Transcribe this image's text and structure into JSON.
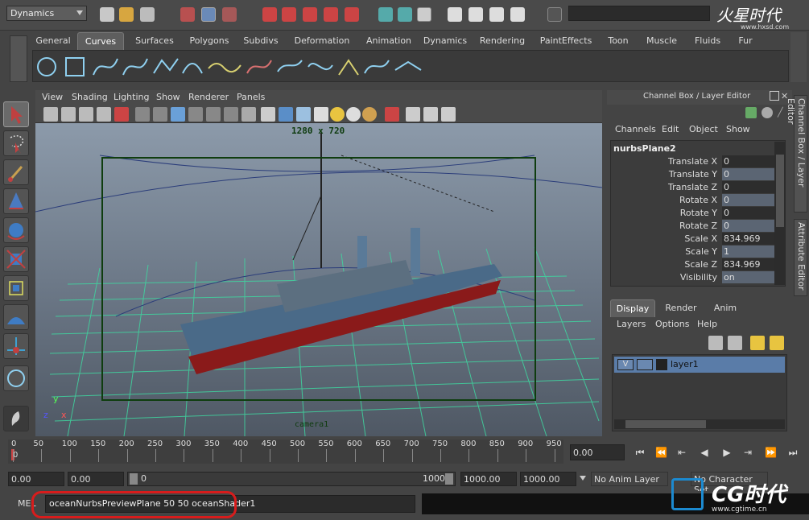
{
  "statusline": {
    "mode": "Dynamics",
    "logo_text": "火星时代",
    "logo_url_small": "www.hxsd.com"
  },
  "shelf": {
    "tabs": [
      "General",
      "Curves",
      "Surfaces",
      "Polygons",
      "Subdivs",
      "Deformation",
      "Animation",
      "Dynamics",
      "Rendering",
      "PaintEffects",
      "Toon",
      "Muscle",
      "Fluids",
      "Fur"
    ],
    "active_tab": "Curves"
  },
  "viewport": {
    "menus": [
      "View",
      "Shading",
      "Lighting",
      "Show",
      "Renderer",
      "Panels"
    ],
    "resolution": "1280 x 720",
    "camera_label": "camera1",
    "axis_y": "y",
    "axis_z": "z",
    "axis_x": "x"
  },
  "channel_box": {
    "title": "Channel Box / Layer Editor",
    "menus": [
      "Channels",
      "Edit",
      "Object",
      "Show"
    ],
    "object_name": "nurbsPlane2",
    "attributes": [
      {
        "label": "Translate X",
        "value": "0"
      },
      {
        "label": "Translate Y",
        "value": "0"
      },
      {
        "label": "Translate Z",
        "value": "0"
      },
      {
        "label": "Rotate X",
        "value": "0"
      },
      {
        "label": "Rotate Y",
        "value": "0"
      },
      {
        "label": "Rotate Z",
        "value": "0"
      },
      {
        "label": "Scale X",
        "value": "834.969"
      },
      {
        "label": "Scale Y",
        "value": "1"
      },
      {
        "label": "Scale Z",
        "value": "834.969"
      },
      {
        "label": "Visibility",
        "value": "on"
      }
    ],
    "side_tabs": [
      "Channel Box / Layer Editor",
      "Attribute Editor"
    ]
  },
  "layer_editor": {
    "tabs": [
      "Display",
      "Render",
      "Anim"
    ],
    "active_tab": "Display",
    "menus": [
      "Layers",
      "Options",
      "Help"
    ],
    "layer": {
      "visibility": "V",
      "name": "layer1"
    }
  },
  "timeline": {
    "ticks": [
      "0",
      "50",
      "100",
      "150",
      "200",
      "250",
      "300",
      "350",
      "400",
      "450",
      "500",
      "550",
      "600",
      "650",
      "700",
      "750",
      "800",
      "850",
      "900",
      "950"
    ],
    "current_frame_marker": "0",
    "current_time": "0.00"
  },
  "range": {
    "start_time": "0.00",
    "playback_start": "0.00",
    "slider_start": "0",
    "slider_end": "1000",
    "playback_end": "1000.00",
    "end_time": "1000.00",
    "anim_layer": "No Anim Layer",
    "character_set": "No Character Set"
  },
  "command_line": {
    "prefix": "MEL",
    "command": "oceanNurbsPreviewPlane 50 50 oceanShader1"
  },
  "watermark": {
    "brand": "CG时代",
    "url": "www.cgtime.cn"
  }
}
